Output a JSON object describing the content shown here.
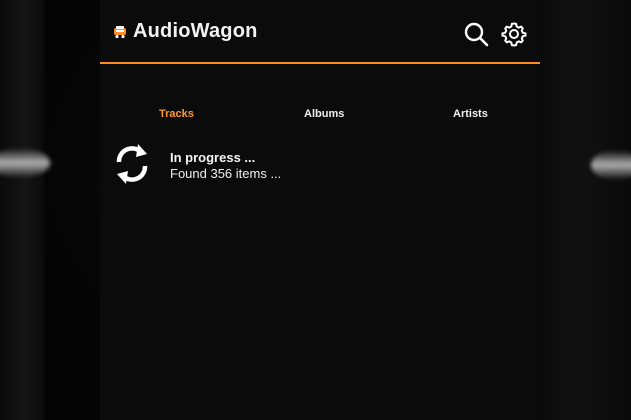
{
  "app": {
    "title": "AudioWagon",
    "logo_icon": "app-logo-icon"
  },
  "actions": {
    "search_icon": "search-icon",
    "settings_icon": "gear-icon"
  },
  "theme": {
    "accent": "#ff8a1e",
    "active_tab": "#ff9a2a",
    "background": "#0b0b0c",
    "text": "#f2f2f2"
  },
  "tabs": [
    {
      "label": "Tracks",
      "active": true
    },
    {
      "label": "Albums",
      "active": false
    },
    {
      "label": "Artists",
      "active": false
    }
  ],
  "status": {
    "icon": "sync-icon",
    "title": "In progress ...",
    "subtitle": "Found 356 items ..."
  }
}
